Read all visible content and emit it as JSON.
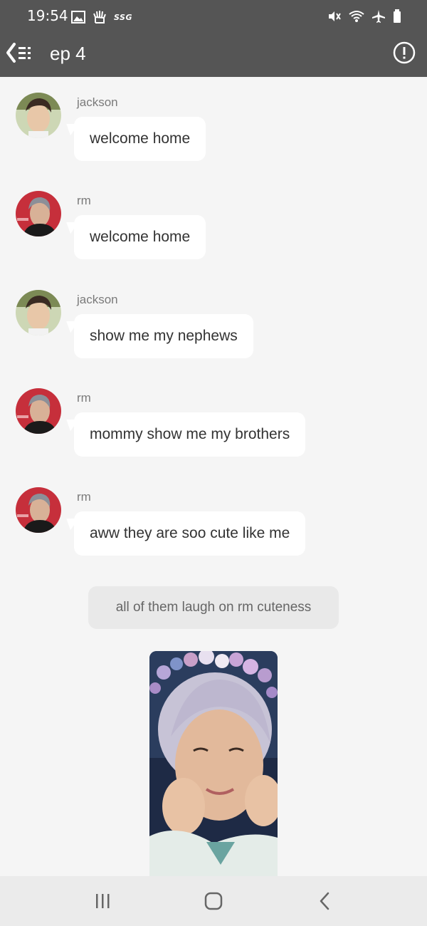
{
  "status_bar": {
    "time": "19:54",
    "network_label": "SSG",
    "left_icons": [
      "gallery-icon",
      "hand-icon"
    ],
    "right_icons": [
      "mute-icon",
      "wifi-icon",
      "airplane-icon",
      "battery-icon"
    ]
  },
  "toolbar": {
    "title": "ep 4",
    "back_icon": "back-menu-icon",
    "info_icon": "info-icon"
  },
  "messages": [
    {
      "sender": "jackson",
      "text": "welcome home"
    },
    {
      "sender": "rm",
      "text": "welcome home"
    },
    {
      "sender": "jackson",
      "text": "show me my nephews"
    },
    {
      "sender": "rm",
      "text": "mommy show me my brothers"
    },
    {
      "sender": "rm",
      "text": "aww they are soo cute like me"
    }
  ],
  "narration": "all of them laugh on rm cuteness",
  "nav_bar": {
    "recent_icon": "recent-apps-icon",
    "home_icon": "home-icon",
    "back_icon": "back-icon"
  },
  "colors": {
    "header_bg": "#555555",
    "chat_bg": "#f5f5f5",
    "bubble_bg": "#ffffff",
    "narration_bg": "#e9e9e9",
    "nav_bg": "#ebebeb"
  }
}
